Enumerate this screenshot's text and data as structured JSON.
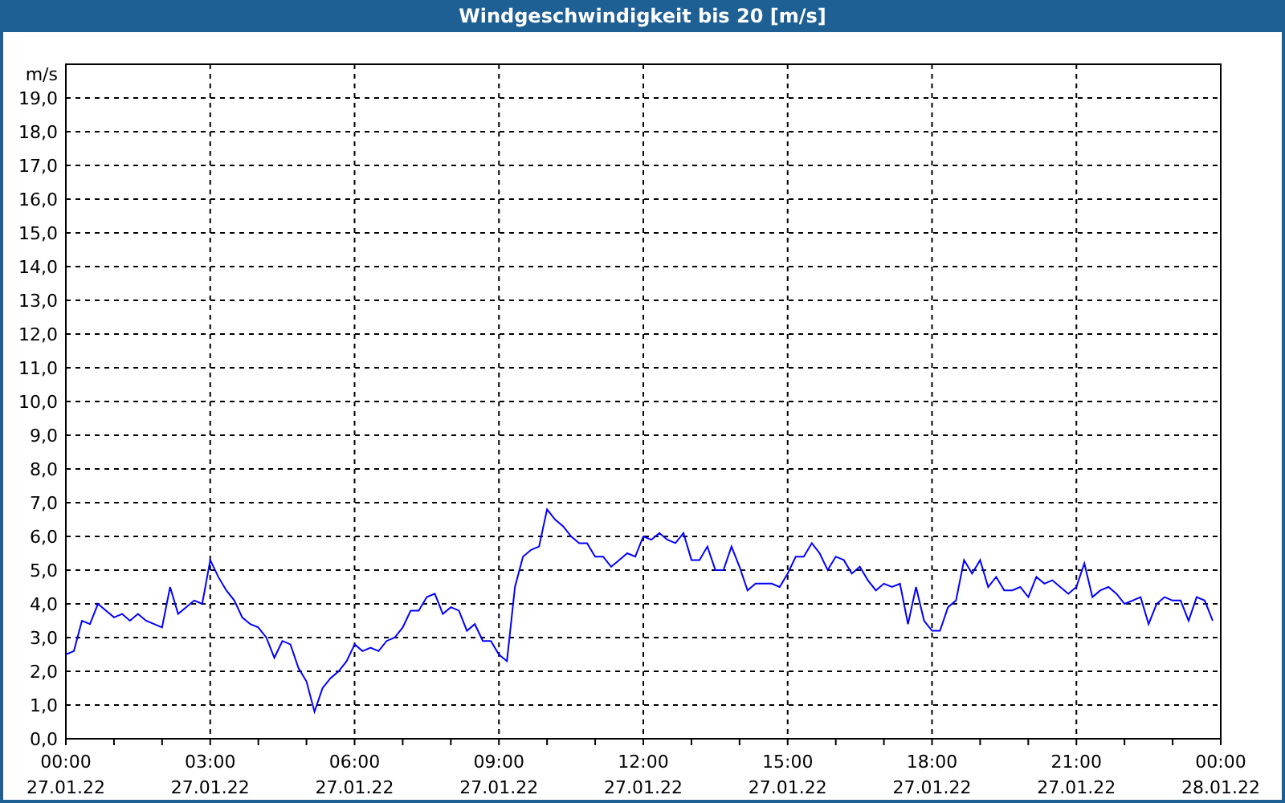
{
  "window": {
    "title": "Windgeschwindigkeit bis 20 [m/s]"
  },
  "chart": {
    "chart_data": {
      "type": "line",
      "ylabel": "m/s",
      "ylim": [
        0,
        20
      ],
      "grid": true,
      "yticks": [
        {
          "value": 0,
          "label": "0,0"
        },
        {
          "value": 1,
          "label": "1,0"
        },
        {
          "value": 2,
          "label": "2,0"
        },
        {
          "value": 3,
          "label": "3,0"
        },
        {
          "value": 4,
          "label": "4,0"
        },
        {
          "value": 5,
          "label": "5,0"
        },
        {
          "value": 6,
          "label": "6,0"
        },
        {
          "value": 7,
          "label": "7,0"
        },
        {
          "value": 8,
          "label": "8,0"
        },
        {
          "value": 9,
          "label": "9,0"
        },
        {
          "value": 10,
          "label": "10,0"
        },
        {
          "value": 11,
          "label": "11,0"
        },
        {
          "value": 12,
          "label": "12,0"
        },
        {
          "value": 13,
          "label": "13,0"
        },
        {
          "value": 14,
          "label": "14,0"
        },
        {
          "value": 15,
          "label": "15,0"
        },
        {
          "value": 16,
          "label": "16,0"
        },
        {
          "value": 17,
          "label": "17,0"
        },
        {
          "value": 18,
          "label": "18,0"
        },
        {
          "value": 19,
          "label": "19,0"
        }
      ],
      "categories": [
        "00:00\n27.01.22",
        null,
        null,
        null,
        null,
        null,
        null,
        null,
        null,
        null,
        null,
        null,
        null,
        null,
        null,
        null,
        null,
        null,
        "03:00\n27.01.22",
        null,
        null,
        null,
        null,
        null,
        null,
        null,
        null,
        null,
        null,
        null,
        null,
        null,
        null,
        null,
        null,
        null,
        "06:00\n27.01.22",
        null,
        null,
        null,
        null,
        null,
        null,
        null,
        null,
        null,
        null,
        null,
        null,
        null,
        null,
        null,
        null,
        null,
        "09:00\n27.01.22",
        null,
        null,
        null,
        null,
        null,
        null,
        null,
        null,
        null,
        null,
        null,
        null,
        null,
        null,
        null,
        null,
        null,
        "12:00\n27.01.22",
        null,
        null,
        null,
        null,
        null,
        null,
        null,
        null,
        null,
        null,
        null,
        null,
        null,
        null,
        null,
        null,
        null,
        "15:00\n27.01.22",
        null,
        null,
        null,
        null,
        null,
        null,
        null,
        null,
        null,
        null,
        null,
        null,
        null,
        null,
        null,
        null,
        null,
        "18:00\n27.01.22",
        null,
        null,
        null,
        null,
        null,
        null,
        null,
        null,
        null,
        null,
        null,
        null,
        null,
        null,
        null,
        null,
        null,
        "21:00\n27.01.22",
        null,
        null,
        null,
        null,
        null,
        null,
        null,
        null,
        null,
        null,
        null,
        null,
        null,
        null,
        null,
        null,
        null,
        "00:00\n28.01.22"
      ],
      "series": [
        {
          "color": "#0000ff",
          "values": [
            2.5,
            2.6,
            3.5,
            3.4,
            4.0,
            3.8,
            3.6,
            3.7,
            3.5,
            3.7,
            3.5,
            3.4,
            3.3,
            4.5,
            3.7,
            3.9,
            4.1,
            4.0,
            5.3,
            4.8,
            4.4,
            4.1,
            3.6,
            3.4,
            3.3,
            3.0,
            2.4,
            2.9,
            2.8,
            2.1,
            1.7,
            0.8,
            1.5,
            1.8,
            2.0,
            2.3,
            2.8,
            2.6,
            2.7,
            2.6,
            2.9,
            3.0,
            3.3,
            3.8,
            3.8,
            4.2,
            4.3,
            3.7,
            3.9,
            3.8,
            3.2,
            3.4,
            2.9,
            2.9,
            2.5,
            2.3,
            4.5,
            5.4,
            5.6,
            5.7,
            6.8,
            6.5,
            6.3,
            6.0,
            5.8,
            5.8,
            5.4,
            5.4,
            5.1,
            5.3,
            5.5,
            5.4,
            6.0,
            5.9,
            6.1,
            5.9,
            5.8,
            6.1,
            5.3,
            5.3,
            5.7,
            5.0,
            5.0,
            5.7,
            5.1,
            4.4,
            4.6,
            4.6,
            4.6,
            4.5,
            4.9,
            5.4,
            5.4,
            5.8,
            5.5,
            5.0,
            5.4,
            5.3,
            4.9,
            5.1,
            4.7,
            4.4,
            4.6,
            4.5,
            4.6,
            3.4,
            4.5,
            3.5,
            3.2,
            3.2,
            3.9,
            4.1,
            5.3,
            4.9,
            5.3,
            4.5,
            4.8,
            4.4,
            4.4,
            4.5,
            4.2,
            4.8,
            4.6,
            4.7,
            4.5,
            4.3,
            4.5,
            5.2,
            4.2,
            4.4,
            4.5,
            4.3,
            4.0,
            4.1,
            4.2,
            3.4,
            4.0,
            4.2,
            4.1,
            4.1,
            3.5,
            4.2,
            4.1,
            3.5,
            null
          ]
        }
      ]
    }
  }
}
